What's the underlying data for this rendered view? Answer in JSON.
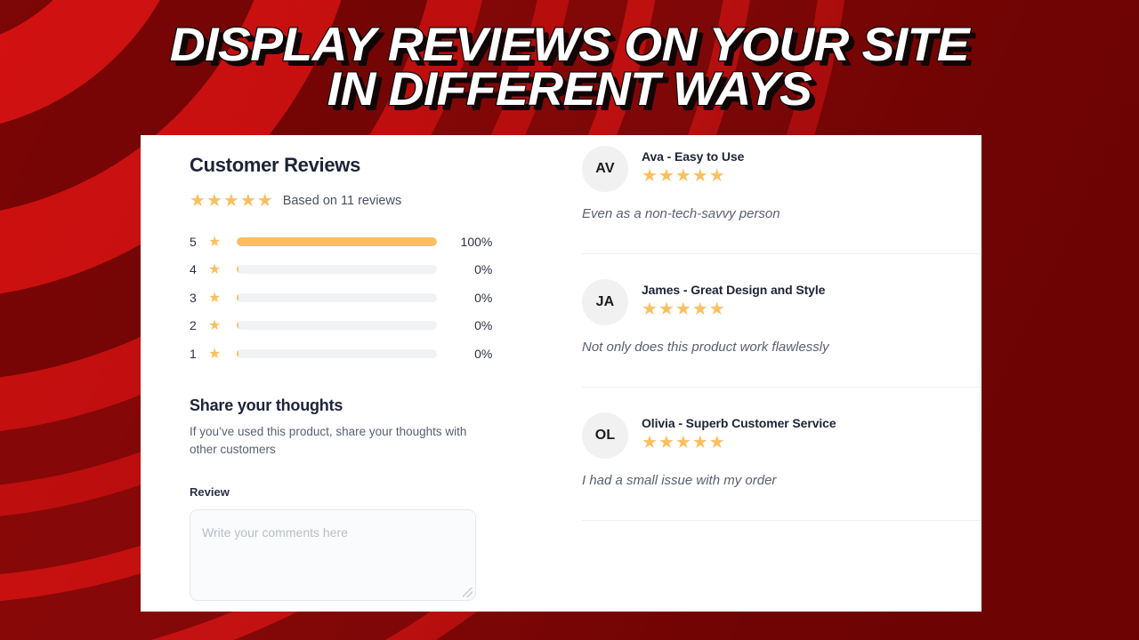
{
  "banner": {
    "headline_line1": "DISPLAY REVIEWS ON YOUR SITE",
    "headline_line2": "IN DIFFERENT WAYS",
    "bg_color_bright": "#cf1111",
    "bg_color_dark": "#8b0707"
  },
  "summary": {
    "title": "Customer Reviews",
    "star_glyph": "★",
    "stars_filled": 5,
    "based_on_text": "Based on 11 reviews",
    "star_color": "#fbbf60",
    "title_color": "#1e2337"
  },
  "distribution": {
    "rows": [
      {
        "label": "5",
        "percent_text": "100%",
        "fill": 100
      },
      {
        "label": "4",
        "percent_text": "0%",
        "fill": 0
      },
      {
        "label": "3",
        "percent_text": "0%",
        "fill": 0
      },
      {
        "label": "2",
        "percent_text": "0%",
        "fill": 0
      },
      {
        "label": "1",
        "percent_text": "0%",
        "fill": 0
      }
    ],
    "track_color": "#f1f2f4",
    "fill_color": "#fbbf60"
  },
  "share": {
    "title": "Share your thoughts",
    "subtitle": "If you’ve used this product, share your thoughts with other customers",
    "review_label": "Review",
    "review_value": "",
    "review_placeholder": "Write your comments here"
  },
  "reviews": [
    {
      "initials": "AV",
      "title": "Ava - Easy to Use",
      "stars": 5,
      "body": "Even as a non-tech-savvy person"
    },
    {
      "initials": "JA",
      "title": "James - Great Design and Style",
      "stars": 5,
      "body": "Not only does this product work flawlessly"
    },
    {
      "initials": "OL",
      "title": "Olivia - Superb Customer Service",
      "stars": 5,
      "body": "I had a small issue with my order"
    }
  ]
}
